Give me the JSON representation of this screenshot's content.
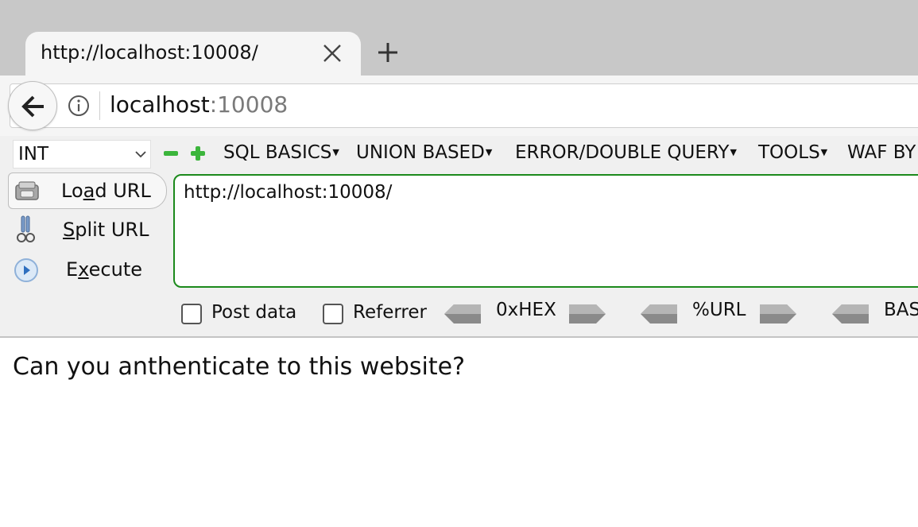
{
  "browser": {
    "tab_title": "http://localhost:10008/",
    "address": {
      "host": "localhost",
      "port": ":10008"
    }
  },
  "hackbar": {
    "select_value": "INT",
    "menus": [
      "SQL BASICS",
      "UNION BASED",
      "ERROR/DOUBLE QUERY",
      "TOOLS",
      "WAF BY"
    ],
    "load_url": {
      "pre": "Lo",
      "key": "a",
      "post": "d URL"
    },
    "split_url": {
      "pre": "",
      "key": "S",
      "post": "plit URL"
    },
    "execute": {
      "pre": "E",
      "key": "x",
      "post": "ecute"
    },
    "url_value": "http://localhost:10008/",
    "post_data_label": "Post data",
    "referrer_label": "Referrer",
    "encoders": [
      "0xHEX",
      "%URL",
      "BAS"
    ]
  },
  "page": {
    "text": "Can you anthenticate to this website?"
  },
  "colors": {
    "tab_strip": "#c8c8c8",
    "toolbar": "#f5f5f5",
    "hackbar": "#f0f0f0",
    "textarea_border": "#1c8a1c",
    "icon_green": "#3bb53b"
  },
  "icons": [
    "close-icon",
    "plus-icon",
    "back-arrow-icon",
    "info-icon",
    "chevron-down-icon",
    "minus-icon",
    "load-url-icon",
    "scissors-icon",
    "play-icon",
    "arrow-left-icon",
    "arrow-right-icon"
  ]
}
